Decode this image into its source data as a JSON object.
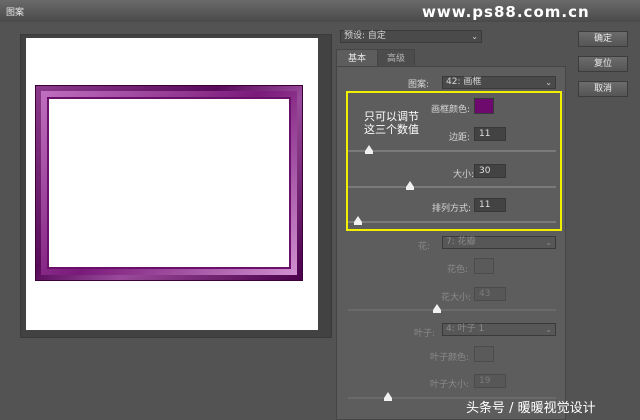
{
  "window": {
    "title": "图案",
    "watermark": "www.ps88.com.cn"
  },
  "preset": {
    "label": "预设: 自定",
    "arrow": "⌄"
  },
  "tabs": {
    "basic": "基本",
    "advanced": "高级"
  },
  "pattern": {
    "label": "图案:",
    "value": "42: 画框"
  },
  "frame_color": {
    "label": "画框颜色:",
    "color": "#6e0a6e"
  },
  "margin": {
    "label": "边距:",
    "value": "11",
    "slider_fraction": 0.1
  },
  "size": {
    "label": "大小:",
    "value": "30",
    "slider_fraction": 0.3
  },
  "arrangement": {
    "label": "排列方式:",
    "value": "11",
    "slider_fraction": 0.05
  },
  "note": {
    "line1": "只可以调节",
    "line2": "这三个数值"
  },
  "flower": {
    "label": "花:",
    "value": "7: 花瓣",
    "color_label": "花色:",
    "size_label": "花大小:",
    "size_value": "43",
    "slider_fraction": 0.43
  },
  "leaf": {
    "label": "叶子:",
    "value": "4: 叶子 1",
    "color_label": "叶子颜色:",
    "size_label": "叶子大小:",
    "size_value": "19",
    "slider_fraction": 0.19
  },
  "buttons": {
    "ok": "确定",
    "reset": "复位",
    "cancel": "取消"
  },
  "footer_watermark": "头条号 / 暖暖视觉设计"
}
